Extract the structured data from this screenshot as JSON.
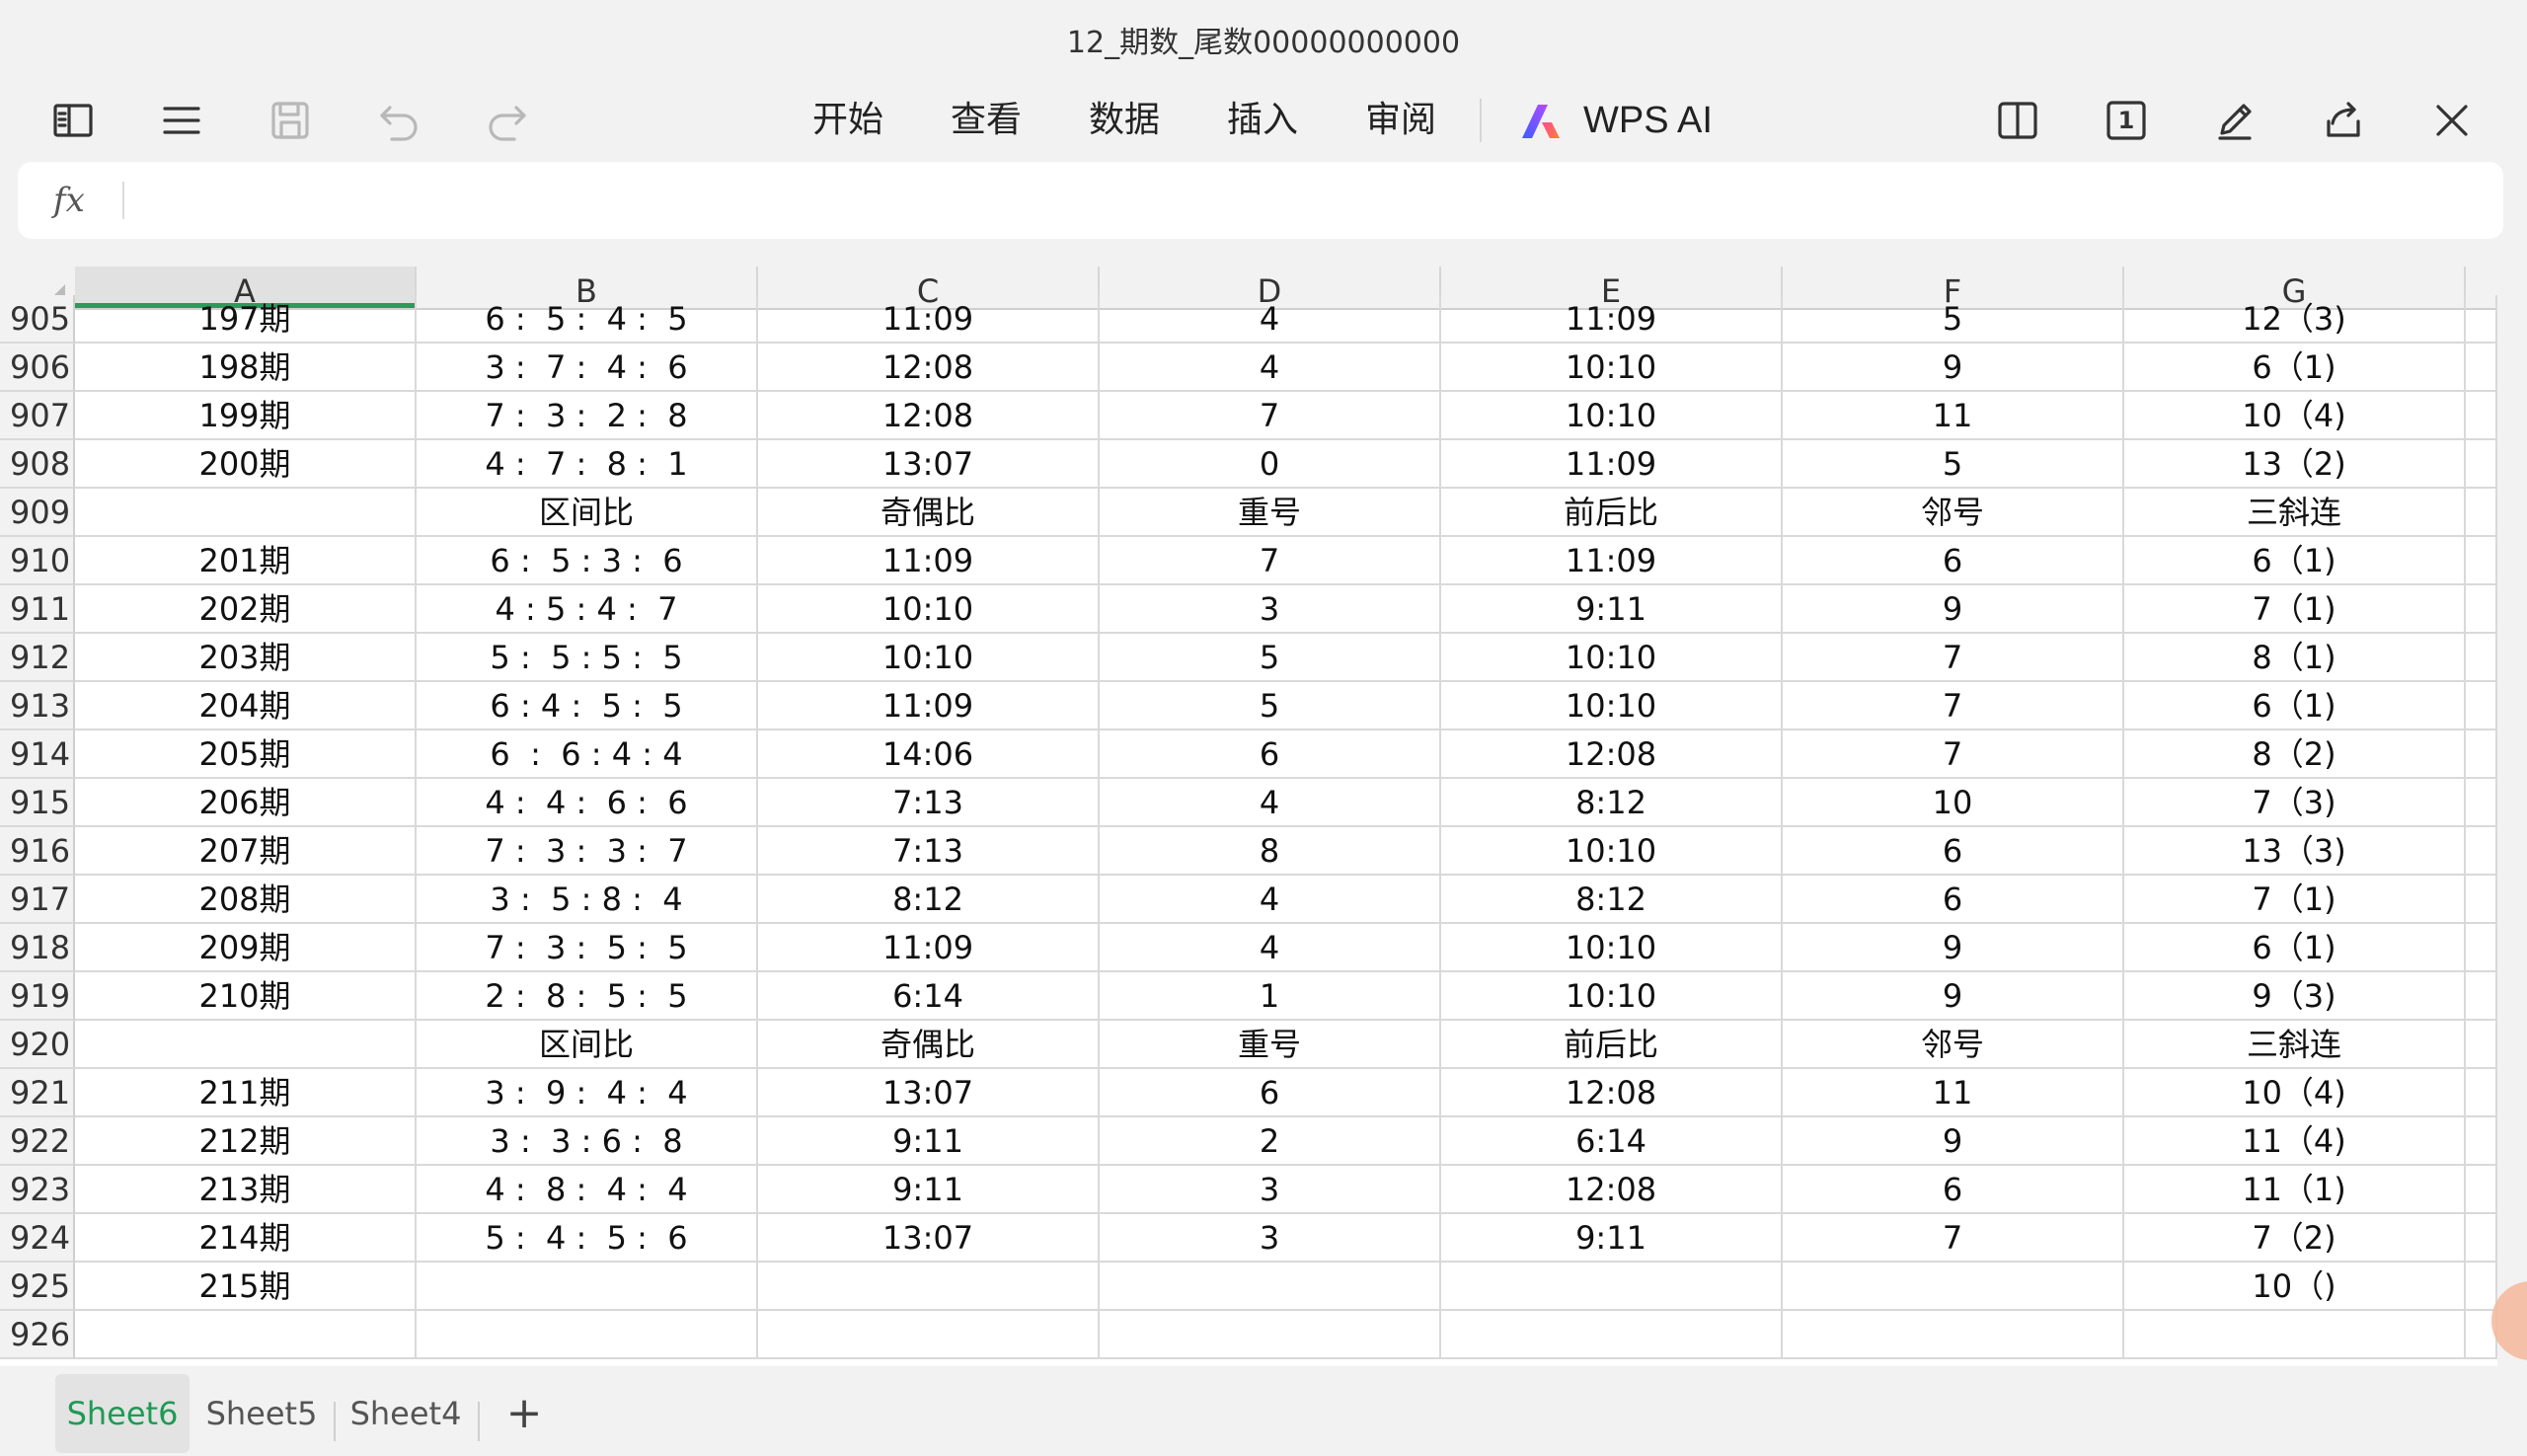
{
  "window": {
    "title": "12_期数_尾数00000000000"
  },
  "toolbar": {
    "left_icons": [
      "sidebar-toggle-icon",
      "menu-icon",
      "save-icon",
      "undo-icon",
      "redo-icon"
    ],
    "menu": [
      {
        "label": "开始"
      },
      {
        "label": "查看"
      },
      {
        "label": "数据"
      },
      {
        "label": "插入"
      },
      {
        "label": "审阅"
      }
    ],
    "ai_label": "WPS AI",
    "right_icons": [
      "split-view-icon",
      "page-number-icon",
      "pen-edit-icon",
      "share-icon",
      "close-icon"
    ],
    "page_number": "1"
  },
  "formula_bar": {
    "fx_label": "fx",
    "value": ""
  },
  "grid": {
    "columns": [
      "A",
      "B",
      "C",
      "D",
      "E",
      "F",
      "G"
    ],
    "active_column": "A",
    "rows": [
      {
        "num": "905",
        "cells": [
          "197期",
          "6 :  5 :  4 :  5",
          "11:09",
          "4",
          "11:09",
          "5",
          "12（3)"
        ]
      },
      {
        "num": "906",
        "cells": [
          "198期",
          "3 :  7 :  4 :  6",
          "12:08",
          "4",
          "10:10",
          "9",
          "6（1)"
        ]
      },
      {
        "num": "907",
        "cells": [
          "199期",
          "7 :  3 :  2 :  8",
          "12:08",
          "7",
          "10:10",
          "11",
          "10（4)"
        ]
      },
      {
        "num": "908",
        "cells": [
          "200期",
          "4 :  7 :  8 :  1",
          "13:07",
          "0",
          "11:09",
          "5",
          "13（2)"
        ]
      },
      {
        "num": "909",
        "cells": [
          "",
          "区间比",
          "奇偶比",
          "重号",
          "前后比",
          "邻号",
          "三斜连"
        ]
      },
      {
        "num": "910",
        "cells": [
          "201期",
          "6 :  5 : 3 :  6",
          "11:09",
          "7",
          "11:09",
          "6",
          "6（1)"
        ]
      },
      {
        "num": "911",
        "cells": [
          "202期",
          "4 : 5 : 4 :  7",
          "10:10",
          "3",
          "9:11",
          "9",
          "7（1)"
        ]
      },
      {
        "num": "912",
        "cells": [
          "203期",
          "5 :  5 : 5 :  5",
          "10:10",
          "5",
          "10:10",
          "7",
          "8（1)"
        ]
      },
      {
        "num": "913",
        "cells": [
          "204期",
          "6 : 4 :  5 :  5",
          "11:09",
          "5",
          "10:10",
          "7",
          "6（1)"
        ]
      },
      {
        "num": "914",
        "cells": [
          "205期",
          "6  :  6 : 4 : 4",
          "14:06",
          "6",
          "12:08",
          "7",
          "8（2)"
        ]
      },
      {
        "num": "915",
        "cells": [
          "206期",
          "4 :  4 :  6 :  6",
          "7:13",
          "4",
          "8:12",
          "10",
          "7（3)"
        ]
      },
      {
        "num": "916",
        "cells": [
          "207期",
          "7 :  3 :  3 :  7",
          "7:13",
          "8",
          "10:10",
          "6",
          "13（3)"
        ]
      },
      {
        "num": "917",
        "cells": [
          "208期",
          "3 :  5 : 8 :  4",
          "8:12",
          "4",
          "8:12",
          "6",
          "7（1)"
        ]
      },
      {
        "num": "918",
        "cells": [
          "209期",
          "7 :  3 :  5 :  5",
          "11:09",
          "4",
          "10:10",
          "9",
          "6（1)"
        ]
      },
      {
        "num": "919",
        "cells": [
          "210期",
          "2 :  8 :  5 :  5",
          "6:14",
          "1",
          "10:10",
          "9",
          "9（3)"
        ]
      },
      {
        "num": "920",
        "cells": [
          "",
          "区间比",
          "奇偶比",
          "重号",
          "前后比",
          "邻号",
          "三斜连"
        ]
      },
      {
        "num": "921",
        "cells": [
          "211期",
          "3 :  9 :  4 :  4",
          "13:07",
          "6",
          "12:08",
          "11",
          "10（4)"
        ]
      },
      {
        "num": "922",
        "cells": [
          "212期",
          "3 :  3 : 6 :  8",
          "9:11",
          "2",
          "6:14",
          "9",
          "11（4)"
        ]
      },
      {
        "num": "923",
        "cells": [
          "213期",
          "4 :  8 :  4 :  4",
          "9:11",
          "3",
          "12:08",
          "6",
          "11（1)"
        ]
      },
      {
        "num": "924",
        "cells": [
          "214期",
          "5 :  4 :  5 :  6",
          "13:07",
          "3",
          "9:11",
          "7",
          "7（2)"
        ]
      },
      {
        "num": "925",
        "cells": [
          "215期",
          "",
          "",
          "",
          "",
          "",
          "10（)"
        ]
      },
      {
        "num": "926",
        "cells": [
          "",
          "",
          "",
          "",
          "",
          "",
          ""
        ]
      }
    ]
  },
  "sheets": {
    "tabs": [
      {
        "label": "Sheet6",
        "active": true
      },
      {
        "label": "Sheet5",
        "active": false
      },
      {
        "label": "Sheet4",
        "active": false
      }
    ],
    "add_label": "+"
  },
  "colors": {
    "active_tab": "#1f9a55",
    "active_column_underline": "#2d9a5c",
    "background": "#f2f2f2"
  }
}
